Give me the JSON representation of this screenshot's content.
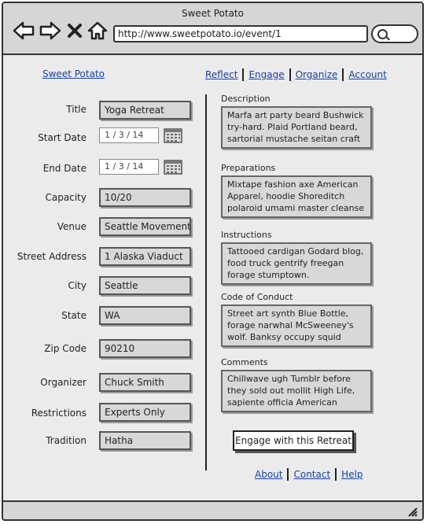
{
  "window": {
    "title": "Sweet Potato",
    "url": "http://www.sweetpotato.io/event/1"
  },
  "nav": {
    "brand": "Sweet Potato",
    "links": [
      "Reflect",
      "Engage",
      "Organize",
      "Account"
    ]
  },
  "form": {
    "title_label": "Title",
    "title_value": "Yoga Retreat",
    "start_label": "Start Date",
    "start_value": "1 / 3 / 14",
    "end_label": "End Date",
    "end_value": "1 / 3 / 14",
    "capacity_label": "Capacity",
    "capacity_value": "10/20",
    "venue_label": "Venue",
    "venue_value": "Seattle Movement",
    "street_label": "Street Address",
    "street_value": "1 Alaska Viaduct",
    "city_label": "City",
    "city_value": "Seattle",
    "state_label": "State",
    "state_value": "WA",
    "zip_label": "Zip Code",
    "zip_value": "90210",
    "organizer_label": "Organizer",
    "organizer_value": "Chuck Smith",
    "restrictions_label": "Restrictions",
    "restrictions_value": "Experts Only",
    "tradition_label": "Tradition",
    "tradition_value": "Hatha"
  },
  "details": {
    "description_title": "Description",
    "description_text": "Marfa art party beard Bushwick try-hard. Plaid Portland beard, sartorial mustache seitan craft beer",
    "preparations_title": "Preparations",
    "preparations_text": "Mixtape fashion axe American Apparel, hoodie Shoreditch polaroid umami master cleanse bushwick chillwave butcher",
    "instructions_title": "Instructions",
    "instructions_text": "Tattooed cardigan Godard blog, food truck gentrify freegan forage stumptown.",
    "conduct_title": "Code of Conduct",
    "conduct_text": "Street art synth Blue Bottle, forage narwhal McSweeney's wolf. Banksy occupy squid gentrify, Etsy vs fap forage",
    "comments_title": "Comments",
    "comments_text": "Chillwave ugh Tumblr before they sold out mollit High Life, sapiente officia American Apparel proident ugh quinoa"
  },
  "cta_label": "Engage with this  Retreat",
  "footer": {
    "links": [
      "About",
      "Contact",
      "Help"
    ]
  }
}
